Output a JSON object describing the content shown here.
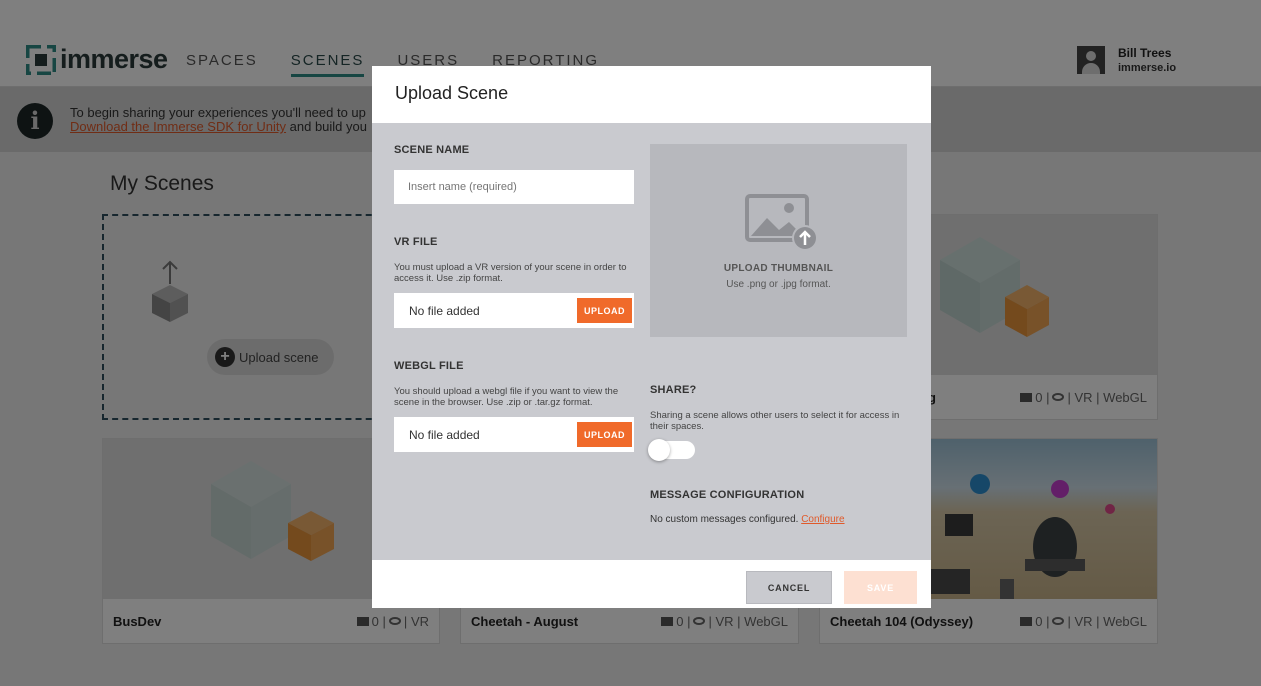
{
  "app": {
    "logo_text": "immerse",
    "nav": [
      {
        "label": "SPACES",
        "active": false
      },
      {
        "label": "SCENES",
        "active": true
      },
      {
        "label": "USERS",
        "active": false
      },
      {
        "label": "REPORTING",
        "active": false
      }
    ],
    "user": {
      "name": "Bill Trees",
      "org": "immerse.io"
    }
  },
  "banner": {
    "line1": "To begin sharing your experiences you'll need to up",
    "link": "Download the Immerse SDK for Unity",
    "line2_suffix": " and build you"
  },
  "page": {
    "title": "My Scenes",
    "upload_scene_label": "Upload scene"
  },
  "cards": [
    {
      "title": "BusDev",
      "messages": "0",
      "sep1": "|",
      "platforms": "VR"
    },
    {
      "title": "Cheetah - August",
      "messages": "0",
      "sep1": "|",
      "platforms": "VR | WebGL"
    },
    {
      "title": "Cheetah 104 (Odyssey)",
      "messages": "0",
      "sep1": "|",
      "platforms": "VR | WebGL"
    },
    {
      "title": "g",
      "messages": "0",
      "sep1": "|",
      "platforms": "VR | WebGL"
    }
  ],
  "modal": {
    "title": "Upload Scene",
    "scene_name": {
      "label": "SCENE NAME",
      "placeholder": "Insert name (required)"
    },
    "vr_file": {
      "label": "VR FILE",
      "help": "You must upload a VR version of your scene in order to access it. Use .zip format.",
      "file": "No file added",
      "button": "UPLOAD"
    },
    "webgl_file": {
      "label": "WEBGL FILE",
      "help": "You should upload a webgl file if you want to view the scene in the browser. Use .zip or .tar.gz format.",
      "file": "No file added",
      "button": "UPLOAD"
    },
    "thumbnail": {
      "label": "UPLOAD THUMBNAIL",
      "sub": "Use .png or .jpg format."
    },
    "share": {
      "label": "SHARE?",
      "help": "Sharing a scene allows other users to select it for access in their spaces.",
      "enabled": false
    },
    "messages": {
      "label": "MESSAGE CONFIGURATION",
      "text": "No custom messages configured.",
      "link": "Configure"
    },
    "cancel": "CANCEL",
    "save": "SAVE"
  },
  "colors": {
    "accent": "#f06a2a",
    "teal": "#2f8d87",
    "overlay": "rgba(0,0,0,0.5)"
  }
}
